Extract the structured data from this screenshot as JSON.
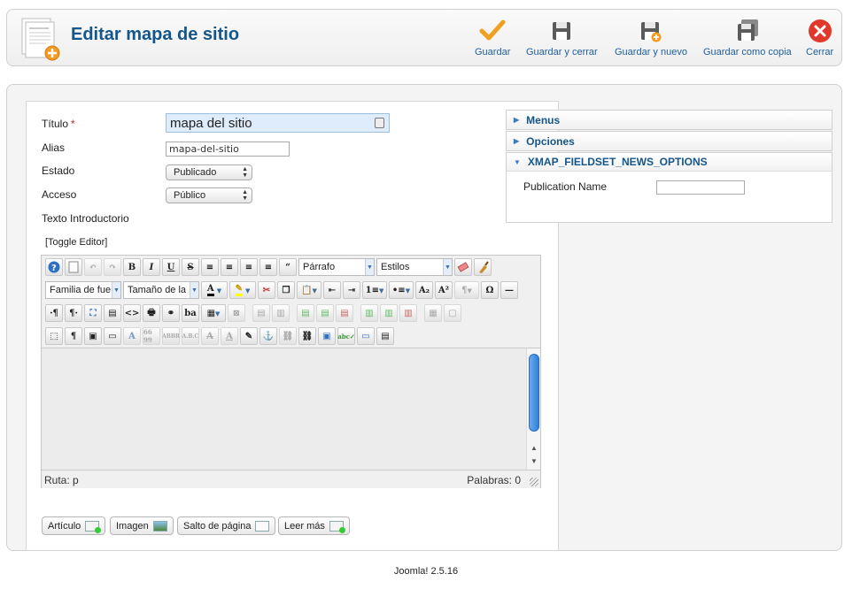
{
  "header": {
    "title": "Editar mapa de sitio",
    "icon": "article-add-icon",
    "buttons": [
      {
        "label": "Guardar",
        "icon": "check-icon",
        "color": "#f0a020"
      },
      {
        "label": "Guardar y cerrar",
        "icon": "floppy-icon"
      },
      {
        "label": "Guardar y nuevo",
        "icon": "floppy-new-icon"
      },
      {
        "label": "Guardar como copia",
        "icon": "floppy-copy-icon"
      },
      {
        "label": "Cerrar",
        "icon": "close-icon",
        "color": "#e0382a"
      }
    ]
  },
  "form": {
    "titulo_label": "Título",
    "required_mark": "*",
    "titulo_value": "mapa del sitio",
    "alias_label": "Alias",
    "alias_value": "mapa-del-sitio",
    "estado_label": "Estado",
    "estado_value": "Publicado",
    "acceso_label": "Acceso",
    "acceso_value": "Público",
    "intro_label": "Texto Introductorio",
    "toggle_editor": "[Toggle Editor]"
  },
  "editor": {
    "format_select": "Párrafo",
    "styles_select": "Estilos",
    "font_family_select": "Familia de fue",
    "font_size_select": "Tamaño de la",
    "status_path": "Ruta:  p",
    "word_count": "Palabras: 0"
  },
  "editor_buttons": [
    {
      "label": "Artículo",
      "icon": "article-icon"
    },
    {
      "label": "Imagen",
      "icon": "image-icon"
    },
    {
      "label": "Salto de página",
      "icon": "pagebreak-icon"
    },
    {
      "label": "Leer más",
      "icon": "readmore-icon"
    }
  ],
  "sidebar": {
    "panels": [
      {
        "label": "Menus",
        "state": "collapsed"
      },
      {
        "label": "Opciones",
        "state": "collapsed"
      },
      {
        "label": "XMAP_FIELDSET_NEWS_OPTIONS",
        "state": "expanded"
      }
    ],
    "publication_name_label": "Publication Name",
    "publication_name_value": ""
  },
  "footer": {
    "text": "Joomla! 2.5.16"
  },
  "colors": {
    "title_blue": "#14568a",
    "link_blue": "#1d5d9b",
    "accent_orange": "#f0a020",
    "close_red": "#e0382a"
  }
}
